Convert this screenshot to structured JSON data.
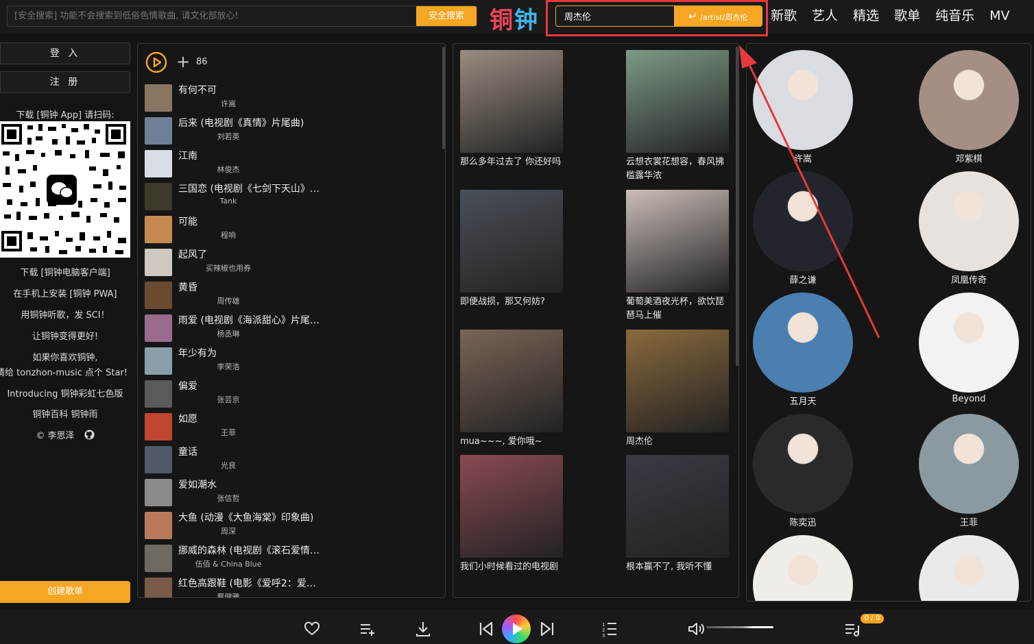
{
  "top": {
    "safe_search_placeholder": "[安全搜索] 功能不会搜索到低俗色情歌曲, 请文化部放心!",
    "safe_search_button": "安全搜索",
    "logo": [
      "铜",
      "钟"
    ],
    "artist_search_value": "周杰伦",
    "artist_search_button": "/artist/周杰伦",
    "nav": [
      "新歌",
      "艺人",
      "精选",
      "歌单",
      "纯音乐",
      "MV"
    ]
  },
  "sidebar": {
    "login": "登 入",
    "register": "注 册",
    "download_app": "下载 [铜钟 App] 请扫码:",
    "links": [
      "下载 [铜钟电脑客户端]",
      "在手机上安装 [铜钟 PWA]",
      "用铜钟听歌，发 SCI！",
      "让铜钟变得更好!",
      "如果你喜欢铜钟,",
      "请给 tonzhon-music 点个 Star!",
      "Introducing 铜钟彩虹七色版",
      "铜钟百科   铜钟雨",
      "©  李思泽"
    ],
    "create_playlist": "创建歌单"
  },
  "songs": {
    "count": "86",
    "items": [
      {
        "title": "有何不可",
        "artist": "许嵩",
        "color": "#8a7560"
      },
      {
        "title": "后来 (电视剧《真情》片尾曲)",
        "artist": "刘若英",
        "color": "#6f7f95"
      },
      {
        "title": "江南",
        "artist": "林俊杰",
        "color": "#d8dde5"
      },
      {
        "title": "三国恋 (电视剧《七剑下天山》…",
        "artist": "Tank",
        "color": "#3d3a2c"
      },
      {
        "title": "可能",
        "artist": "程响",
        "color": "#c48a4f"
      },
      {
        "title": "起风了",
        "artist": "买辣椒也用券",
        "color": "#cfc9c2"
      },
      {
        "title": "黄昏",
        "artist": "周传雄",
        "color": "#6b4a32"
      },
      {
        "title": "雨爱 (电视剧《海派甜心》片尾…",
        "artist": "杨丞琳",
        "color": "#9a6b8c"
      },
      {
        "title": "年少有为",
        "artist": "李荣浩",
        "color": "#8aa0a8"
      },
      {
        "title": "偏爱",
        "artist": "张芸京",
        "color": "#5a5a5a"
      },
      {
        "title": "如愿",
        "artist": "王菲",
        "color": "#c2452f"
      },
      {
        "title": "童话",
        "artist": "光良",
        "color": "#4f5a66"
      },
      {
        "title": "爱如潮水",
        "artist": "张信哲",
        "color": "#8c8a86"
      },
      {
        "title": "大鱼 (动漫《大鱼海棠》印象曲)",
        "artist": "周深",
        "color": "#b97a5c"
      },
      {
        "title": "挪威的森林 (电视剧《滚石爱情…",
        "artist": "伍佰 & China Blue",
        "color": "#6f6a60"
      },
      {
        "title": "红色高跟鞋 (电影《爱呼2：爱…",
        "artist": "蔡健雅",
        "color": "#7a5a48"
      }
    ]
  },
  "cards": [
    {
      "caption": "那么多年过去了 你还好吗",
      "color": "#9a8c80"
    },
    {
      "caption": "云想衣裳花想容，春风拂槛露华浓",
      "color": "#7d9a86"
    },
    {
      "caption": "即便战损，那又何妨?",
      "color": "#4a5058"
    },
    {
      "caption": "葡萄美酒夜光杯，欲饮琵琶马上催",
      "color": "#c9bdb8"
    },
    {
      "caption": "mua~~~, 爱你哦~",
      "color": "#7a6456"
    },
    {
      "caption": "周杰伦",
      "color": "#8a6a3c"
    },
    {
      "caption": "我们小时候看过的电视剧",
      "color": "#8a4a52"
    },
    {
      "caption": "根本赢不了, 我听不懂",
      "color": "#3a3a44"
    }
  ],
  "artists": [
    {
      "name": "许嵩",
      "color": "#d9dde2"
    },
    {
      "name": "邓紫棋",
      "color": "#a58f84"
    },
    {
      "name": "薛之谦",
      "color": "#22262c"
    },
    {
      "name": "凤凰传奇",
      "color": "#e7e2dd"
    },
    {
      "name": "五月天",
      "color": "#4a7fb0"
    },
    {
      "name": "Beyond",
      "color": "#f2f2f2"
    },
    {
      "name": "陈奕迅",
      "color": "#2a2a2a"
    },
    {
      "name": "王菲",
      "color": "#8a9aa0"
    },
    {
      "name": "",
      "color": "#f0ede8"
    },
    {
      "name": "",
      "color": "#eaeaea"
    }
  ],
  "player": {
    "queue_badge": "0 / 0",
    "accent": "#f5a623",
    "icons": [
      "heart-icon",
      "add-to-queue-icon",
      "download-icon",
      "previous-icon",
      "play-icon",
      "next-icon",
      "playlist-icon",
      "volume-icon",
      "queue-icon"
    ]
  }
}
